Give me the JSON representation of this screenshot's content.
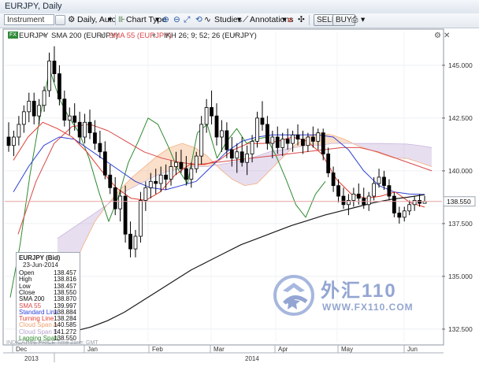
{
  "window": {
    "title": "EURJPY, Daily"
  },
  "toolbar": {
    "instrument_placeholder": "Instrument",
    "period_label": "Daily, Auto",
    "chart_type_label": "Chart Type",
    "studies_label": "Studies",
    "annotations_label": "Annotations",
    "sell_label": "SELL",
    "buy_label": "BUY"
  },
  "legend": {
    "symbol": "EURJPY",
    "fx_badge": "FX",
    "sma200": "SMA 200 (EURJPY)",
    "sma55": "SMA 55 (EURJPY)",
    "ikh": "IKH 26; 9; 52; 26 (EURJPY)"
  },
  "colors": {
    "up_candle": "#ffffff",
    "down_candle": "#000000",
    "sma200": "#1a1a1a",
    "sma55": "#d94848",
    "standard_line": "#2d3fd6",
    "turning_line": "#e23b2e",
    "cloud_span_a": "#f5b98a",
    "cloud_span_b": "#c9b6dc",
    "lagging_span": "#2f8a2f",
    "price_marker": "#e7a0a0"
  },
  "data_window": {
    "title": "EURJPY (Bid)",
    "date": "23-Jun-2014",
    "rows": [
      {
        "label": "Open",
        "value": "138.457",
        "color": "#111111"
      },
      {
        "label": "High",
        "value": "138.816",
        "color": "#111111"
      },
      {
        "label": "Low",
        "value": "138.457",
        "color": "#111111"
      },
      {
        "label": "Close",
        "value": "138.550",
        "color": "#111111"
      },
      {
        "label": "SMA 200",
        "value": "138.870",
        "color": "#111111"
      },
      {
        "label": "SMA 55",
        "value": "139.997",
        "color": "#d94848"
      },
      {
        "label": "Standard Line",
        "value": "138.884",
        "color": "#2d3fd6"
      },
      {
        "label": "Turning Line",
        "value": "138.284",
        "color": "#e23b2e"
      },
      {
        "label": "Cloud Span A",
        "value": "140.585",
        "color": "#f0a070"
      },
      {
        "label": "Cloud Span B",
        "value": "141.272",
        "color": "#b7a2cf"
      },
      {
        "label": "Lagging Span",
        "value": "138.550",
        "color": "#2f8a2f"
      }
    ]
  },
  "footer": {
    "indicative": "INDICATIVE PRICE",
    "timezone": "Time Zone: GMT"
  },
  "watermark": {
    "cn": "外汇110",
    "url": "WWW.FX110.COM"
  },
  "chart_data": {
    "type": "candlestick",
    "symbol": "EURJPY",
    "timeframe": "Daily",
    "y_axis_labels": [
      "145.000",
      "142.500",
      "140.000",
      "137.500",
      "135.000",
      "132.500"
    ],
    "y_axis_values": [
      145.0,
      142.5,
      140.0,
      137.5,
      135.0,
      132.5
    ],
    "ylim": [
      131.9,
      146.6
    ],
    "current_price_label": "138.550",
    "current_price": 138.55,
    "months": [
      "Dec",
      "Jan",
      "Feb",
      "Mar",
      "Apr",
      "May",
      "Jun"
    ],
    "years": [
      {
        "label": "2013"
      },
      {
        "label": "2014"
      }
    ],
    "ohlc": [
      [
        141.6,
        142.3,
        140.9,
        141.2
      ],
      [
        141.2,
        141.9,
        140.7,
        141.6
      ],
      [
        141.6,
        142.6,
        141.2,
        142.2
      ],
      [
        142.2,
        143.1,
        141.8,
        142.8
      ],
      [
        142.8,
        143.7,
        142.3,
        143.3
      ],
      [
        143.3,
        143.7,
        142.2,
        142.6
      ],
      [
        142.6,
        143.4,
        142.2,
        143.1
      ],
      [
        143.1,
        144.0,
        142.8,
        143.8
      ],
      [
        143.8,
        145.6,
        143.5,
        145.2
      ],
      [
        145.2,
        145.9,
        144.2,
        144.6
      ],
      [
        144.6,
        145.0,
        143.1,
        143.4
      ],
      [
        143.4,
        143.8,
        142.1,
        142.4
      ],
      [
        142.4,
        143.0,
        141.7,
        142.6
      ],
      [
        142.6,
        143.2,
        141.9,
        142.3
      ],
      [
        142.3,
        142.8,
        141.3,
        141.6
      ],
      [
        141.6,
        142.7,
        141.3,
        142.3
      ],
      [
        142.3,
        142.9,
        141.5,
        141.8
      ],
      [
        141.8,
        142.4,
        141.0,
        141.3
      ],
      [
        141.3,
        141.9,
        140.6,
        140.9
      ],
      [
        140.9,
        141.4,
        139.6,
        139.8
      ],
      [
        139.8,
        140.3,
        138.9,
        139.2
      ],
      [
        139.2,
        139.7,
        137.9,
        138.2
      ],
      [
        138.2,
        139.1,
        137.6,
        138.8
      ],
      [
        138.8,
        139.3,
        136.6,
        137.0
      ],
      [
        137.0,
        137.6,
        135.9,
        136.3
      ],
      [
        136.3,
        137.2,
        135.9,
        136.9
      ],
      [
        136.9,
        139.0,
        136.6,
        138.6
      ],
      [
        138.6,
        139.5,
        138.1,
        139.2
      ],
      [
        139.2,
        139.9,
        138.7,
        139.5
      ],
      [
        139.5,
        140.1,
        138.9,
        139.4
      ],
      [
        139.4,
        140.2,
        139.0,
        139.8
      ],
      [
        139.8,
        140.3,
        139.1,
        139.6
      ],
      [
        139.6,
        140.5,
        139.3,
        140.2
      ],
      [
        140.2,
        140.9,
        139.8,
        140.4
      ],
      [
        140.4,
        141.0,
        139.9,
        140.1
      ],
      [
        140.1,
        140.7,
        139.3,
        139.6
      ],
      [
        139.6,
        140.4,
        139.2,
        140.1
      ],
      [
        140.1,
        140.9,
        139.9,
        140.7
      ],
      [
        140.7,
        142.6,
        140.3,
        142.2
      ],
      [
        142.2,
        143.4,
        141.8,
        143.0
      ],
      [
        143.0,
        143.8,
        142.2,
        142.6
      ],
      [
        142.6,
        143.2,
        141.2,
        141.6
      ],
      [
        141.6,
        142.4,
        140.9,
        141.9
      ],
      [
        141.9,
        142.3,
        140.6,
        141.0
      ],
      [
        141.0,
        141.6,
        140.2,
        140.6
      ],
      [
        140.6,
        141.3,
        139.9,
        140.9
      ],
      [
        140.9,
        141.6,
        140.2,
        140.4
      ],
      [
        140.4,
        141.2,
        139.8,
        140.8
      ],
      [
        140.8,
        141.7,
        140.4,
        141.4
      ],
      [
        141.4,
        142.8,
        141.1,
        142.5
      ],
      [
        142.5,
        143.3,
        141.9,
        142.2
      ],
      [
        142.2,
        142.6,
        141.0,
        141.3
      ],
      [
        141.3,
        141.9,
        140.6,
        141.6
      ],
      [
        141.6,
        142.1,
        140.8,
        141.1
      ],
      [
        141.1,
        141.8,
        140.7,
        141.5
      ],
      [
        141.5,
        142.0,
        141.0,
        141.3
      ],
      [
        141.3,
        141.9,
        140.9,
        141.7
      ],
      [
        141.7,
        142.2,
        141.2,
        141.5
      ],
      [
        141.5,
        141.9,
        140.8,
        141.2
      ],
      [
        141.2,
        141.8,
        140.9,
        141.6
      ],
      [
        141.6,
        142.1,
        141.1,
        141.4
      ],
      [
        141.4,
        142.0,
        141.0,
        141.8
      ],
      [
        141.8,
        142.0,
        140.5,
        140.8
      ],
      [
        140.8,
        141.1,
        139.7,
        139.9
      ],
      [
        139.9,
        140.2,
        139.0,
        139.3
      ],
      [
        139.3,
        139.6,
        138.5,
        138.8
      ],
      [
        138.8,
        139.2,
        138.2,
        138.4
      ],
      [
        138.4,
        138.9,
        137.9,
        138.6
      ],
      [
        138.6,
        139.2,
        138.3,
        138.9
      ],
      [
        138.9,
        139.4,
        138.4,
        138.7
      ],
      [
        138.7,
        139.2,
        138.2,
        138.4
      ],
      [
        138.4,
        139.0,
        138.1,
        138.8
      ],
      [
        138.8,
        139.7,
        138.6,
        139.4
      ],
      [
        139.4,
        140.1,
        139.2,
        139.7
      ],
      [
        139.7,
        140.0,
        139.1,
        139.3
      ],
      [
        139.3,
        139.6,
        138.6,
        138.8
      ],
      [
        138.8,
        139.0,
        137.8,
        138.0
      ],
      [
        138.0,
        138.3,
        137.5,
        137.8
      ],
      [
        137.8,
        138.3,
        137.6,
        138.1
      ],
      [
        138.1,
        138.6,
        137.9,
        138.4
      ],
      [
        138.4,
        138.8,
        138.1,
        138.6
      ],
      [
        138.6,
        138.9,
        138.3,
        138.46
      ],
      [
        138.46,
        138.82,
        138.46,
        138.55
      ]
    ],
    "sma200": [
      132.2,
      132.4,
      132.6,
      132.9,
      133.3,
      133.8,
      134.3,
      134.8,
      135.3,
      135.7,
      136.1,
      136.5,
      136.8,
      137.1,
      137.4,
      137.65,
      137.9,
      138.1,
      138.3,
      138.5,
      138.65,
      138.75,
      138.87
    ],
    "sma55": [
      137.0,
      139.5,
      141.3,
      142.1,
      142.2,
      141.9,
      141.4,
      140.9,
      140.6,
      140.4,
      140.3,
      140.4,
      140.5,
      140.6,
      140.7,
      140.8,
      140.9,
      141.0,
      141.1,
      141.1,
      140.9,
      140.6,
      140.3,
      140.0
    ],
    "standard_line": [
      139.0,
      140.2,
      141.2,
      141.6,
      141.5,
      141.0,
      140.5,
      140.0,
      139.5,
      139.2,
      139.1,
      139.3,
      139.5,
      140.2,
      140.9,
      141.4,
      141.6,
      141.7,
      141.7,
      141.7,
      141.7,
      141.6,
      141.0,
      140.0,
      139.3,
      139.0,
      138.9,
      138.88
    ],
    "turning_line": [
      140.5,
      141.6,
      142.3,
      142.0,
      141.6,
      140.9,
      140.0,
      139.2,
      138.7,
      138.6,
      139.0,
      139.8,
      140.3,
      140.3,
      140.5,
      141.0,
      141.3,
      141.3,
      141.4,
      141.6,
      141.4,
      140.8,
      139.6,
      138.9,
      138.7,
      138.8,
      139.0,
      138.5,
      138.28
    ],
    "cloud_span_a": [
      134.0,
      135.0,
      136.4,
      137.6,
      138.4,
      139.1,
      139.7,
      140.2,
      140.7,
      141.1,
      141.3,
      141.1,
      140.7,
      140.1,
      139.6,
      139.3,
      139.4,
      140.0,
      140.6,
      141.2,
      141.6,
      141.8,
      141.7,
      141.5,
      141.2,
      141.0,
      140.8,
      140.6,
      140.59,
      140.4,
      140.2
    ],
    "cloud_span_b": [
      136.8,
      137.2,
      137.6,
      138.0,
      138.4,
      138.9,
      139.2,
      139.5,
      139.8,
      140.0,
      140.1,
      140.2,
      140.2,
      140.3,
      140.4,
      140.5,
      140.7,
      140.9,
      141.0,
      141.1,
      141.2,
      141.2,
      141.3,
      141.3,
      141.3,
      141.3,
      141.3,
      141.28,
      141.27,
      141.2,
      141.1
    ],
    "lagging_span": [
      134.0,
      136.5,
      139.8,
      142.5,
      144.8,
      143.4,
      142.5,
      141.8,
      140.6,
      139.0,
      137.6,
      138.8,
      140.4,
      141.4,
      142.5,
      142.2,
      141.2,
      140.1,
      139.4,
      141.8,
      142.2,
      140.6,
      141.4,
      142.0,
      141.3,
      141.5,
      141.6,
      140.7,
      139.6,
      138.4,
      137.8,
      138.9,
      139.5
    ]
  }
}
